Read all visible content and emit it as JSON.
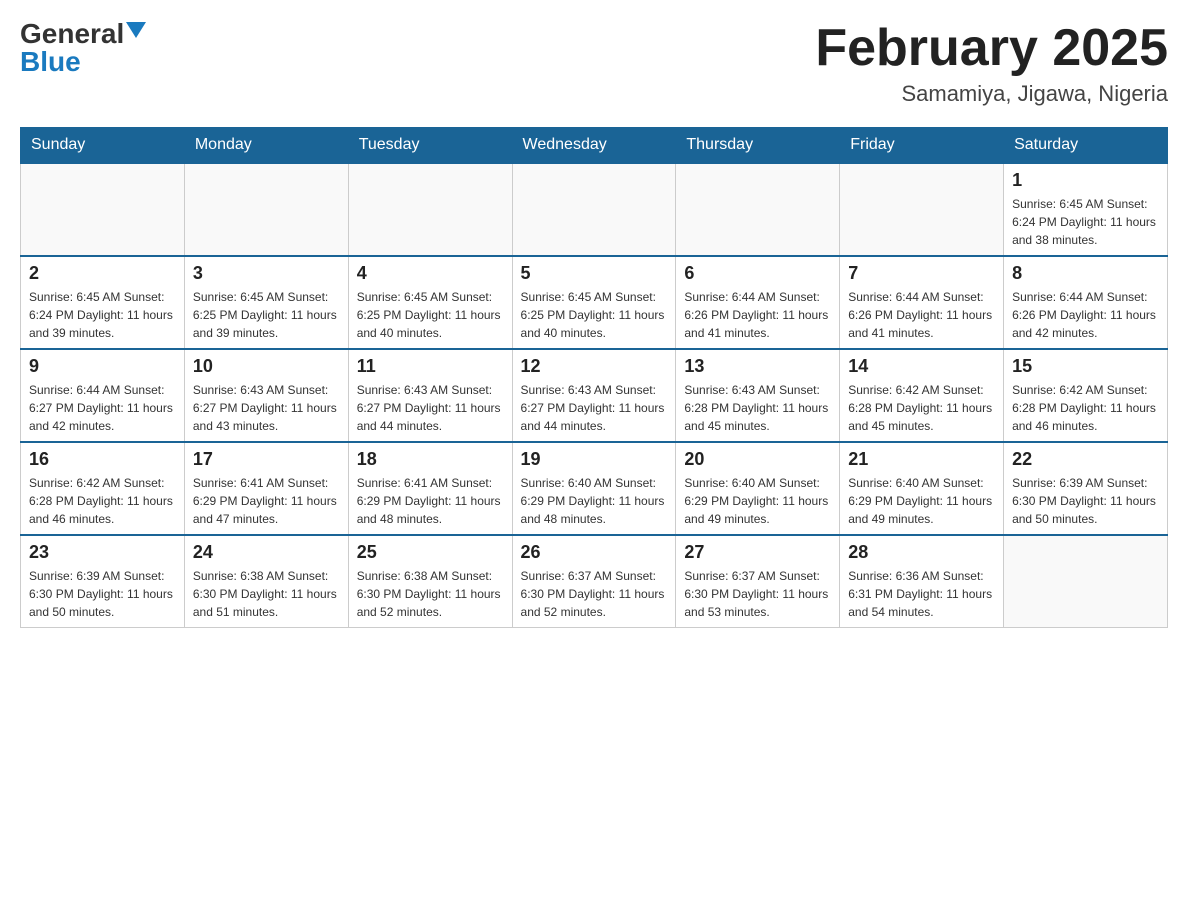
{
  "header": {
    "logo": {
      "general_text": "General",
      "blue_text": "Blue"
    },
    "title": "February 2025",
    "subtitle": "Samamiya, Jigawa, Nigeria"
  },
  "days_of_week": [
    "Sunday",
    "Monday",
    "Tuesday",
    "Wednesday",
    "Thursday",
    "Friday",
    "Saturday"
  ],
  "weeks": [
    {
      "days": [
        {
          "number": "",
          "info": ""
        },
        {
          "number": "",
          "info": ""
        },
        {
          "number": "",
          "info": ""
        },
        {
          "number": "",
          "info": ""
        },
        {
          "number": "",
          "info": ""
        },
        {
          "number": "",
          "info": ""
        },
        {
          "number": "1",
          "info": "Sunrise: 6:45 AM\nSunset: 6:24 PM\nDaylight: 11 hours\nand 38 minutes."
        }
      ]
    },
    {
      "days": [
        {
          "number": "2",
          "info": "Sunrise: 6:45 AM\nSunset: 6:24 PM\nDaylight: 11 hours\nand 39 minutes."
        },
        {
          "number": "3",
          "info": "Sunrise: 6:45 AM\nSunset: 6:25 PM\nDaylight: 11 hours\nand 39 minutes."
        },
        {
          "number": "4",
          "info": "Sunrise: 6:45 AM\nSunset: 6:25 PM\nDaylight: 11 hours\nand 40 minutes."
        },
        {
          "number": "5",
          "info": "Sunrise: 6:45 AM\nSunset: 6:25 PM\nDaylight: 11 hours\nand 40 minutes."
        },
        {
          "number": "6",
          "info": "Sunrise: 6:44 AM\nSunset: 6:26 PM\nDaylight: 11 hours\nand 41 minutes."
        },
        {
          "number": "7",
          "info": "Sunrise: 6:44 AM\nSunset: 6:26 PM\nDaylight: 11 hours\nand 41 minutes."
        },
        {
          "number": "8",
          "info": "Sunrise: 6:44 AM\nSunset: 6:26 PM\nDaylight: 11 hours\nand 42 minutes."
        }
      ]
    },
    {
      "days": [
        {
          "number": "9",
          "info": "Sunrise: 6:44 AM\nSunset: 6:27 PM\nDaylight: 11 hours\nand 42 minutes."
        },
        {
          "number": "10",
          "info": "Sunrise: 6:43 AM\nSunset: 6:27 PM\nDaylight: 11 hours\nand 43 minutes."
        },
        {
          "number": "11",
          "info": "Sunrise: 6:43 AM\nSunset: 6:27 PM\nDaylight: 11 hours\nand 44 minutes."
        },
        {
          "number": "12",
          "info": "Sunrise: 6:43 AM\nSunset: 6:27 PM\nDaylight: 11 hours\nand 44 minutes."
        },
        {
          "number": "13",
          "info": "Sunrise: 6:43 AM\nSunset: 6:28 PM\nDaylight: 11 hours\nand 45 minutes."
        },
        {
          "number": "14",
          "info": "Sunrise: 6:42 AM\nSunset: 6:28 PM\nDaylight: 11 hours\nand 45 minutes."
        },
        {
          "number": "15",
          "info": "Sunrise: 6:42 AM\nSunset: 6:28 PM\nDaylight: 11 hours\nand 46 minutes."
        }
      ]
    },
    {
      "days": [
        {
          "number": "16",
          "info": "Sunrise: 6:42 AM\nSunset: 6:28 PM\nDaylight: 11 hours\nand 46 minutes."
        },
        {
          "number": "17",
          "info": "Sunrise: 6:41 AM\nSunset: 6:29 PM\nDaylight: 11 hours\nand 47 minutes."
        },
        {
          "number": "18",
          "info": "Sunrise: 6:41 AM\nSunset: 6:29 PM\nDaylight: 11 hours\nand 48 minutes."
        },
        {
          "number": "19",
          "info": "Sunrise: 6:40 AM\nSunset: 6:29 PM\nDaylight: 11 hours\nand 48 minutes."
        },
        {
          "number": "20",
          "info": "Sunrise: 6:40 AM\nSunset: 6:29 PM\nDaylight: 11 hours\nand 49 minutes."
        },
        {
          "number": "21",
          "info": "Sunrise: 6:40 AM\nSunset: 6:29 PM\nDaylight: 11 hours\nand 49 minutes."
        },
        {
          "number": "22",
          "info": "Sunrise: 6:39 AM\nSunset: 6:30 PM\nDaylight: 11 hours\nand 50 minutes."
        }
      ]
    },
    {
      "days": [
        {
          "number": "23",
          "info": "Sunrise: 6:39 AM\nSunset: 6:30 PM\nDaylight: 11 hours\nand 50 minutes."
        },
        {
          "number": "24",
          "info": "Sunrise: 6:38 AM\nSunset: 6:30 PM\nDaylight: 11 hours\nand 51 minutes."
        },
        {
          "number": "25",
          "info": "Sunrise: 6:38 AM\nSunset: 6:30 PM\nDaylight: 11 hours\nand 52 minutes."
        },
        {
          "number": "26",
          "info": "Sunrise: 6:37 AM\nSunset: 6:30 PM\nDaylight: 11 hours\nand 52 minutes."
        },
        {
          "number": "27",
          "info": "Sunrise: 6:37 AM\nSunset: 6:30 PM\nDaylight: 11 hours\nand 53 minutes."
        },
        {
          "number": "28",
          "info": "Sunrise: 6:36 AM\nSunset: 6:31 PM\nDaylight: 11 hours\nand 54 minutes."
        },
        {
          "number": "",
          "info": ""
        }
      ]
    }
  ]
}
